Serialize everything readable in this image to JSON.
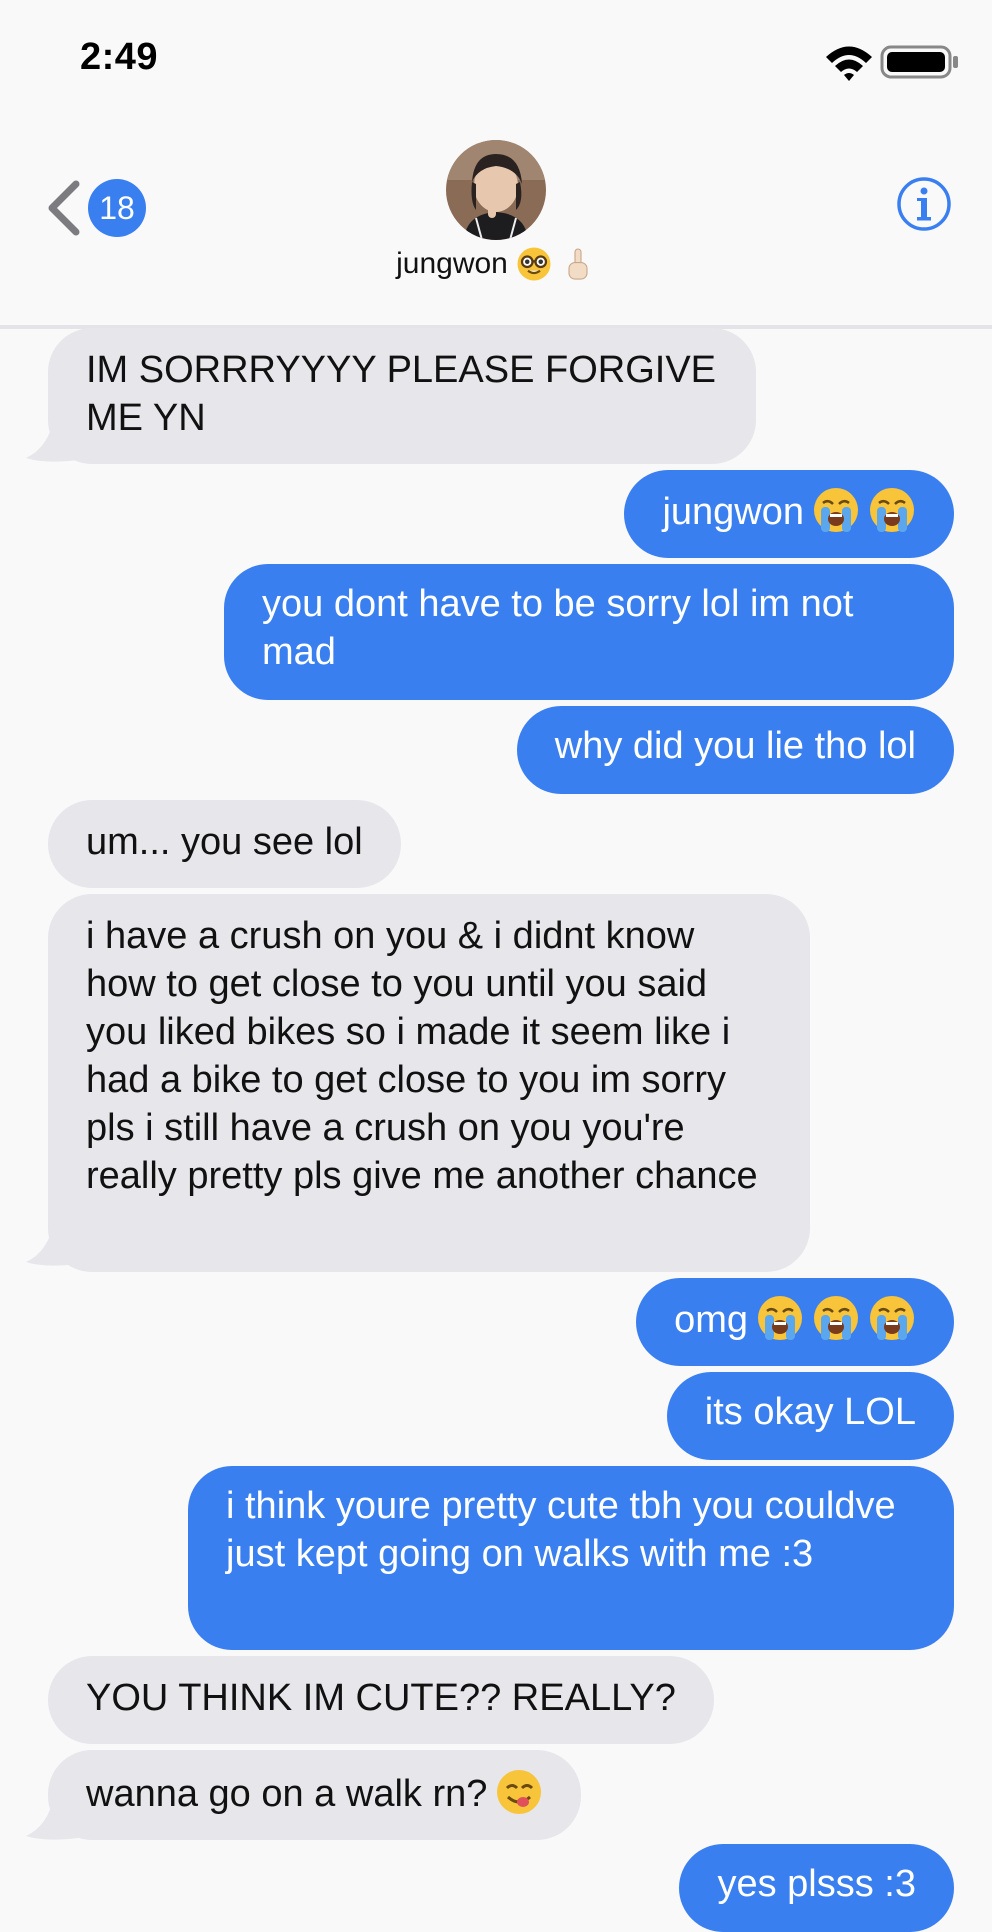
{
  "status_bar": {
    "time": "2:49",
    "wifi_icon": "wifi-icon",
    "battery_icon": "battery-icon"
  },
  "header": {
    "back_icon": "chevron-left-icon",
    "unread_count": "18",
    "contact_name": "jungwon",
    "name_emojis": [
      "nerd-face-emoji",
      "index-pointing-up-emoji"
    ],
    "info_icon": "info-icon"
  },
  "colors": {
    "outgoing_bubble": "#3a7ff0",
    "incoming_bubble": "#e6e6eb",
    "background": "#f9f9fa"
  },
  "messages": [
    {
      "direction": "incoming",
      "text": "IM SORRRYYYY PLEASE FORGIVE ME YN"
    },
    {
      "direction": "outgoing",
      "text": "jungwon",
      "emojis": [
        "loudly-crying-face",
        "loudly-crying-face"
      ]
    },
    {
      "direction": "outgoing",
      "text": "you dont have to be sorry lol im not mad"
    },
    {
      "direction": "outgoing",
      "text": "why did you lie tho lol"
    },
    {
      "direction": "incoming",
      "text": "um... you see lol"
    },
    {
      "direction": "incoming",
      "text": "i have a crush on you & i didnt know how to get close to you until you said you liked bikes so i made it seem like i had a bike to get close to you im sorry pls i still have a crush on you you're really pretty pls give me another chance"
    },
    {
      "direction": "outgoing",
      "text": "omg",
      "emojis": [
        "loudly-crying-face",
        "loudly-crying-face",
        "loudly-crying-face"
      ]
    },
    {
      "direction": "outgoing",
      "text": "its okay LOL"
    },
    {
      "direction": "outgoing",
      "text": "i think youre pretty cute tbh you couldve just kept going on walks with me :3"
    },
    {
      "direction": "incoming",
      "text": "YOU THINK IM CUTE?? REALLY?"
    },
    {
      "direction": "incoming",
      "text": "wanna go on a walk rn?",
      "emojis": [
        "face-savoring-food"
      ]
    },
    {
      "direction": "outgoing",
      "text": "yes plsss :3"
    }
  ]
}
